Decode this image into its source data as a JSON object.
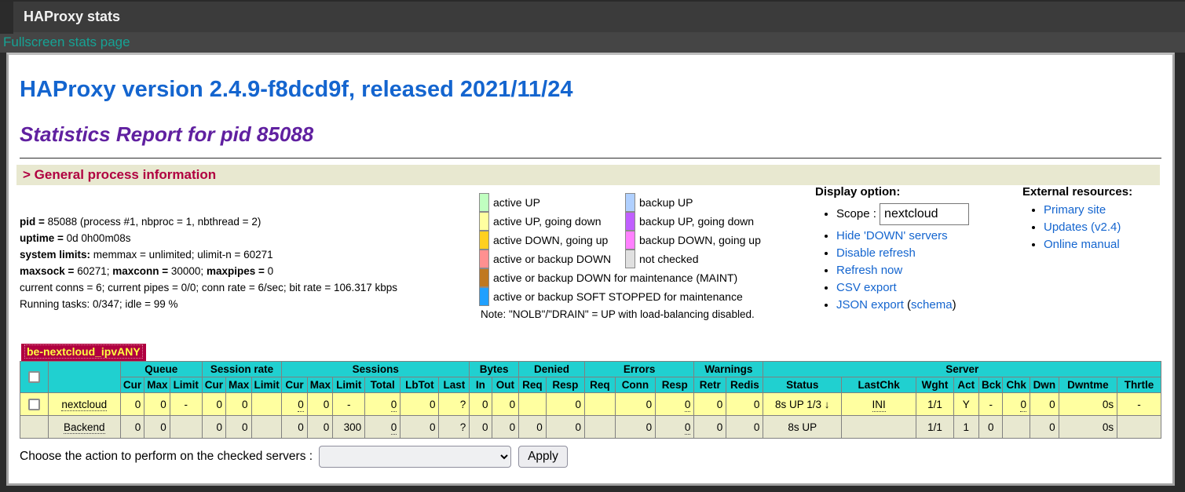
{
  "window": {
    "title": "HAProxy stats",
    "fullscreen_link": "Fullscreen stats page"
  },
  "heading": {
    "h1": "HAProxy version 2.4.9-f8dcd9f, released 2021/11/24",
    "h2": "Statistics Report for pid 85088",
    "section": "> General process information"
  },
  "process_info": {
    "l1b": "pid = ",
    "l1": "85088 (process #1, nbproc = 1, nbthread = 2)",
    "l2b": "uptime = ",
    "l2": "0d 0h00m08s",
    "l3b": "system limits:",
    "l3": " memmax = unlimited; ulimit-n = 60271",
    "l4b1": "maxsock = ",
    "l4t1": "60271; ",
    "l4b2": "maxconn = ",
    "l4t2": "30000; ",
    "l4b3": "maxpipes = ",
    "l4t3": "0",
    "l5": "current conns = 6; current pipes = 0/0; conn rate = 6/sec; bit rate = 106.317 kbps",
    "l6": "Running tasks: 0/347; idle = 99 %"
  },
  "legend": {
    "pairs": [
      {
        "lcolor": "#c0ffc0",
        "llabel": "active UP",
        "rcolor": "#b0d0ff",
        "rlabel": "backup UP"
      },
      {
        "lcolor": "#ffffa0",
        "llabel": "active UP, going down",
        "rcolor": "#c060ff",
        "rlabel": "backup UP, going down"
      },
      {
        "lcolor": "#ffd020",
        "llabel": "active DOWN, going up",
        "rcolor": "#ff80ff",
        "rlabel": "backup DOWN, going up"
      },
      {
        "lcolor": "#ff9090",
        "llabel": "active or backup DOWN",
        "rcolor": "#e0e0e0",
        "rlabel": "not checked"
      }
    ],
    "wide": [
      {
        "color": "#c07820",
        "label": "active or backup DOWN for maintenance (MAINT)"
      },
      {
        "color": "#20a0ff",
        "label": "active or backup SOFT STOPPED for maintenance"
      }
    ],
    "note": "Note: \"NOLB\"/\"DRAIN\" = UP with load-balancing disabled."
  },
  "display_option": {
    "heading": "Display option:",
    "scope_label": "Scope : ",
    "scope_value": "nextcloud",
    "links": [
      "Hide 'DOWN' servers",
      "Disable refresh",
      "Refresh now",
      "CSV export"
    ],
    "json_link": "JSON export",
    "json_mid": " (",
    "schema_link": "schema",
    "json_end": ")"
  },
  "external_resources": {
    "heading": "External resources:",
    "links": [
      "Primary site",
      "Updates (v2.4)",
      "Online manual"
    ]
  },
  "stats_table": {
    "proxy_name": "be-nextcloud_ipvANY",
    "groups": [
      {
        "label": "Queue"
      },
      {
        "label": "Session rate"
      },
      {
        "label": "Sessions"
      },
      {
        "label": "Bytes"
      },
      {
        "label": "Denied"
      },
      {
        "label": "Errors"
      },
      {
        "label": "Warnings"
      },
      {
        "label": "Server"
      }
    ],
    "columns": [
      "Cur",
      "Max",
      "Limit",
      "Cur",
      "Max",
      "Limit",
      "Cur",
      "Max",
      "Limit",
      "Total",
      "LbTot",
      "Last",
      "In",
      "Out",
      "Req",
      "Resp",
      "Req",
      "Conn",
      "Resp",
      "Retr",
      "Redis",
      "Status",
      "LastChk",
      "Wght",
      "Act",
      "Bck",
      "Chk",
      "Dwn",
      "Dwntme",
      "Thrtle"
    ],
    "rows": [
      {
        "name": "nextcloud",
        "row_color": "#ffffa0",
        "cells": [
          "0",
          "0",
          "-",
          "0",
          "0",
          "",
          "0",
          "0",
          "-",
          "0",
          "0",
          "?",
          "0",
          "0",
          "",
          "0",
          "",
          "0",
          "0",
          "0",
          "0",
          "8s UP 1/3 ↓",
          "INI",
          "1/1",
          "Y",
          "-",
          "0",
          "0",
          "0s",
          "-"
        ]
      },
      {
        "name": "Backend",
        "row_color": "#e8e8d0",
        "cells": [
          "0",
          "0",
          "",
          "0",
          "0",
          "",
          "0",
          "0",
          "300",
          "0",
          "0",
          "?",
          "0",
          "0",
          "0",
          "0",
          "",
          "0",
          "0",
          "0",
          "0",
          "8s UP",
          "",
          "1/1",
          "1",
          "0",
          "",
          "0",
          "0s",
          ""
        ]
      }
    ]
  },
  "action_bar": {
    "label": "Choose the action to perform on the checked servers :",
    "apply_label": "Apply"
  },
  "colors": {
    "table_header": "#20d0d0",
    "proxy_name_bg": "#b00040",
    "proxy_name_fg": "#ffff40",
    "section_bg": "#e8e8d0",
    "section_fg": "#b00040"
  }
}
